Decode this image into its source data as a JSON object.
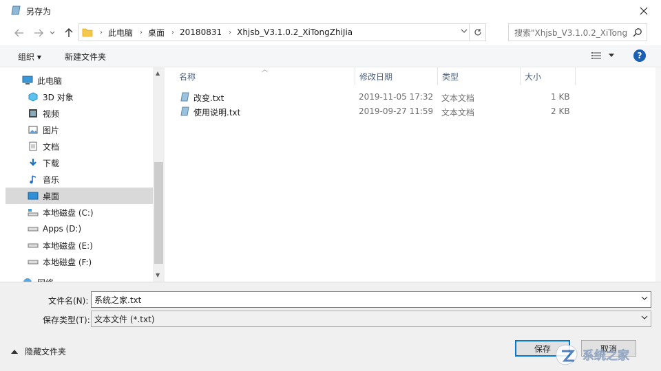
{
  "window": {
    "title": "另存为"
  },
  "address": {
    "crumbs": [
      "此电脑",
      "桌面",
      "20180831",
      "Xhjsb_V3.1.0.2_XiTongZhiJia"
    ]
  },
  "search": {
    "placeholder": "搜索\"Xhjsb_V3.1.0.2_XiTong..."
  },
  "toolbar": {
    "organize": "组织 ▾",
    "new_folder": "新建文件夹"
  },
  "nav": {
    "items": [
      {
        "label": "此电脑",
        "icon": "computer-icon"
      },
      {
        "label": "3D 对象",
        "icon": "3d-objects-icon"
      },
      {
        "label": "视频",
        "icon": "video-icon"
      },
      {
        "label": "图片",
        "icon": "pictures-icon"
      },
      {
        "label": "文档",
        "icon": "documents-icon"
      },
      {
        "label": "下载",
        "icon": "download-icon"
      },
      {
        "label": "音乐",
        "icon": "music-icon"
      },
      {
        "label": "桌面",
        "icon": "desktop-icon"
      },
      {
        "label": "本地磁盘 (C:)",
        "icon": "drive-icon"
      },
      {
        "label": "Apps (D:)",
        "icon": "drive-icon"
      },
      {
        "label": "本地磁盘 (E:)",
        "icon": "drive-icon"
      },
      {
        "label": "本地磁盘 (F:)",
        "icon": "drive-icon"
      },
      {
        "label": "网络",
        "icon": "network-icon"
      }
    ]
  },
  "columns": {
    "name": "名称",
    "modified": "修改日期",
    "type": "类型",
    "size": "大小"
  },
  "files": [
    {
      "name": "改变.txt",
      "modified": "2019-11-05 17:32",
      "type": "文本文档",
      "size": "1 KB"
    },
    {
      "name": "使用说明.txt",
      "modified": "2019-09-27 11:59",
      "type": "文本文档",
      "size": "2 KB"
    }
  ],
  "form": {
    "filename_label": "文件名(N):",
    "filename_value": "系统之家.txt",
    "filetype_label": "保存类型(T):",
    "filetype_value": "文本文件 (*.txt)"
  },
  "footer": {
    "hide_folders": "隐藏文件夹",
    "save": "保存",
    "cancel": "取消",
    "watermark": "系统之家"
  },
  "colors": {
    "accent": "#0078d7",
    "selection": "#d9d9d9",
    "help": "#1a5fb4"
  }
}
